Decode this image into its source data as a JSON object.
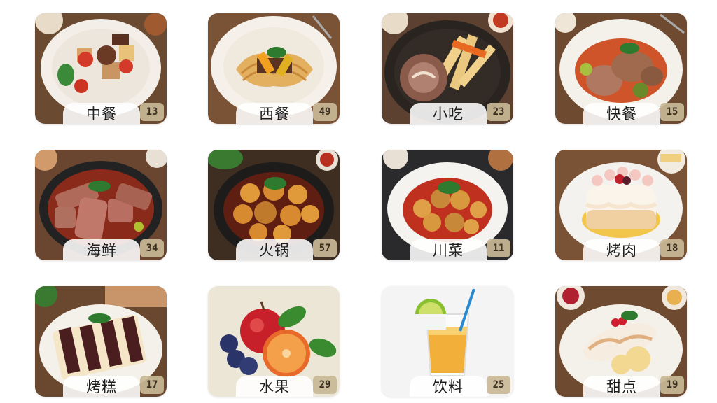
{
  "categories": [
    {
      "label": "中餐",
      "count": "13",
      "icon": "chinese-food-image",
      "style": "wood"
    },
    {
      "label": "西餐",
      "count": "49",
      "icon": "western-food-image",
      "style": "wood"
    },
    {
      "label": "小吃",
      "count": "23",
      "icon": "snack-image",
      "style": "wood"
    },
    {
      "label": "快餐",
      "count": "15",
      "icon": "fast-food-image",
      "style": "wood"
    },
    {
      "label": "海鲜",
      "count": "34",
      "icon": "seafood-image",
      "style": "wood"
    },
    {
      "label": "火锅",
      "count": "57",
      "icon": "hotpot-image",
      "style": "wood"
    },
    {
      "label": "川菜",
      "count": "11",
      "icon": "sichuan-dish-image",
      "style": "dark"
    },
    {
      "label": "烤肉",
      "count": "18",
      "icon": "bbq-image",
      "style": "wood"
    },
    {
      "label": "烤糕",
      "count": "17",
      "icon": "cake-image",
      "style": "wood"
    },
    {
      "label": "水果",
      "count": "29",
      "icon": "fruit-image",
      "style": "light"
    },
    {
      "label": "饮料",
      "count": "25",
      "icon": "drink-image",
      "style": "white"
    },
    {
      "label": "甜点",
      "count": "19",
      "icon": "dessert-image",
      "style": "wood"
    }
  ]
}
